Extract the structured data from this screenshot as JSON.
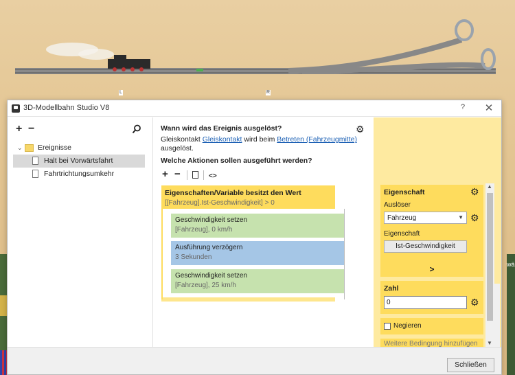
{
  "scene": {
    "markers": [
      "L",
      "R"
    ],
    "right_strip_text": "wäh"
  },
  "window": {
    "title": "3D-Modellbahn Studio V8",
    "help_symbol": "?",
    "close_symbol": "✕"
  },
  "left_pane": {
    "add": "+",
    "remove": "−",
    "search_icon": "search-icon",
    "tree": [
      {
        "label": "Ereignisse",
        "type": "folder",
        "expanded": true
      },
      {
        "label": "Halt bei Vorwärtsfahrt",
        "type": "event",
        "selected": true
      },
      {
        "label": "Fahrtrichtungsumkehr",
        "type": "event",
        "selected": false
      }
    ]
  },
  "center": {
    "trigger_question": "Wann wird das Ereignis ausgelöst?",
    "trigger_prefix": "Gleiskontakt",
    "trigger_link1": "Gleiskontakt",
    "trigger_mid": "wird beim",
    "trigger_link2": "Betreten (Fahrzeugmitte)",
    "trigger_suffix": "ausgelöst.",
    "actions_question": "Welche Aktionen sollen ausgeführt werden?",
    "toolbar": {
      "add": "+",
      "remove": "−",
      "code": "<>"
    },
    "condition": {
      "title": "Eigenschaften/Variable besitzt den Wert",
      "subtitle": "[[Fahrzeug].Ist-Geschwindigkeit] > 0"
    },
    "actions": [
      {
        "title": "Geschwindigkeit setzen",
        "subtitle": "[Fahrzeug], 0 km/h",
        "color": "#c6e2ae"
      },
      {
        "title": "Ausführung verzögern",
        "subtitle": "3 Sekunden",
        "color": "#a5c6e6"
      },
      {
        "title": "Geschwindigkeit setzen",
        "subtitle": "[Fahrzeug], 25 km/h",
        "color": "#c6e2ae"
      }
    ]
  },
  "properties": {
    "block1": {
      "heading": "Eigenschaft",
      "trigger_label": "Auslöser",
      "trigger_value": "Fahrzeug",
      "property_label": "Eigenschaft",
      "property_button": "Ist-Geschwindigkeit"
    },
    "compare_button": ">",
    "block2": {
      "heading": "Zahl",
      "value": "0"
    },
    "negate_label": "Negieren",
    "add_condition": "Weitere Bedingung hinzufügen"
  },
  "footer": {
    "close_button": "Schließen"
  },
  "colors": {
    "condition": "#fedc5d",
    "action_green": "#c6e2ae",
    "action_blue": "#a5c6e6",
    "panel_bg": "#feeaa0",
    "link": "#1a5fb4"
  }
}
